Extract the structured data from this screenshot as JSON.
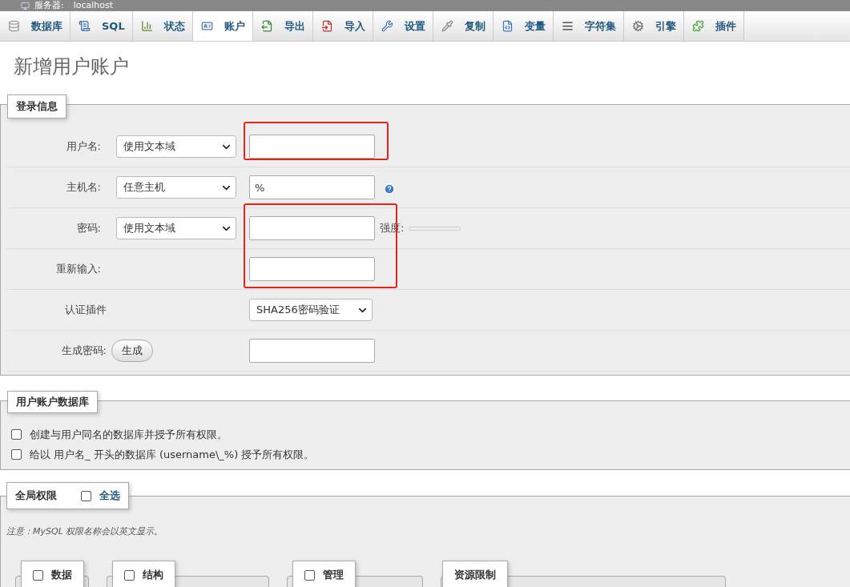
{
  "server_bar": {
    "label": "服务器:",
    "value": "localhost"
  },
  "tabs": [
    {
      "label": "数据库",
      "selected": false
    },
    {
      "label": "SQL",
      "selected": false
    },
    {
      "label": "状态",
      "selected": false
    },
    {
      "label": "账户",
      "selected": true
    },
    {
      "label": "导出",
      "selected": false
    },
    {
      "label": "导入",
      "selected": false
    },
    {
      "label": "设置",
      "selected": false
    },
    {
      "label": "复制",
      "selected": false
    },
    {
      "label": "变量",
      "selected": false
    },
    {
      "label": "字符集",
      "selected": false
    },
    {
      "label": "引擎",
      "selected": false
    },
    {
      "label": "插件",
      "selected": false
    }
  ],
  "title": "新增用户账户",
  "login": {
    "legend": "登录信息",
    "rows": [
      {
        "kind": "select_input",
        "label": "用户名:",
        "select": "使用文本域",
        "highlighted": true
      },
      {
        "kind": "select_input",
        "label": "主机名:",
        "select": "任意主机",
        "value": "%",
        "help": true,
        "highlighted": false
      },
      {
        "kind": "select_input",
        "label": "密码:",
        "select": "使用文本域",
        "highlighted": true,
        "strength": {
          "label": "强度:",
          "level": 0
        }
      },
      {
        "kind": "input",
        "label": "重新输入:",
        "highlighted": true
      },
      {
        "kind": "plugin",
        "label": "认证插件",
        "select": "SHA256密码验证",
        "highlighted": false
      },
      {
        "kind": "generate",
        "label": "生成密码:",
        "button": "生成",
        "highlighted": false
      }
    ]
  },
  "database": {
    "legend": "用户账户数据库",
    "options": [
      {
        "label": "创建与用户同名的数据库并授予所有权限。",
        "checked": false
      },
      {
        "label": "给以 用户名_ 开头的数据库 (username\\_%) 授予所有权限。",
        "checked": false
      }
    ]
  },
  "global": {
    "legend": "全局权限",
    "select_all": {
      "label": "全选",
      "checked": false
    },
    "note": "注意：MySQL 权限名称会以英文显示。",
    "groups": [
      {
        "kind": "checkbox",
        "label": "数据",
        "checked": false
      },
      {
        "kind": "checkbox",
        "label": "结构",
        "checked": false
      },
      {
        "kind": "checkbox",
        "label": "管理",
        "checked": false
      },
      {
        "kind": "plain",
        "label": "资源限制"
      }
    ]
  }
}
